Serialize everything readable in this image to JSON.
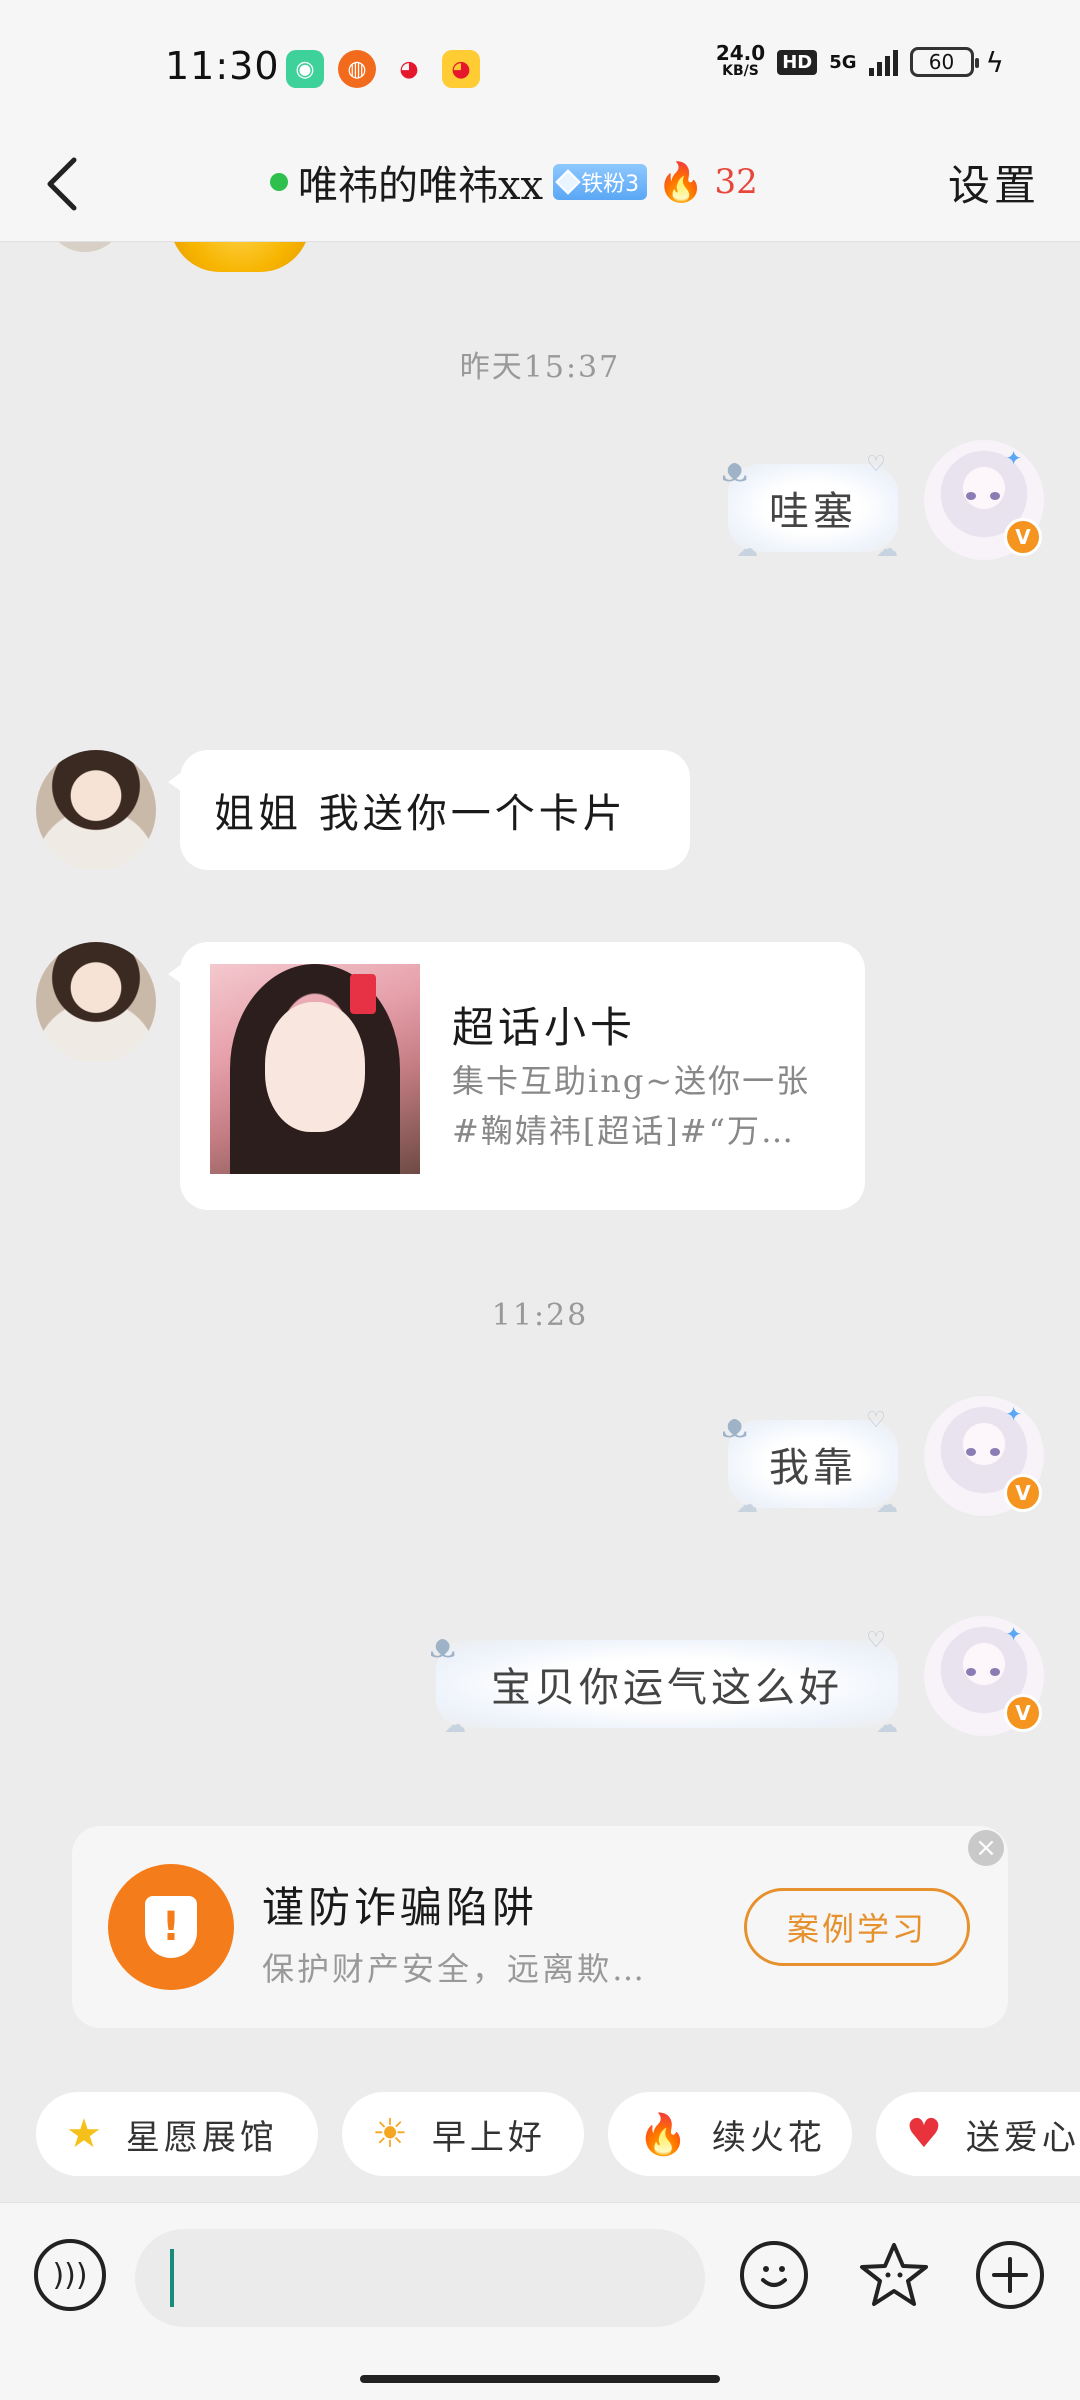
{
  "status_bar": {
    "time": "11:30",
    "net_speed_value": "24.0",
    "net_speed_unit": "KB/S",
    "hd": "HD",
    "network": "5G",
    "battery": "60",
    "apps": [
      "app-icon-green",
      "app-icon-orange",
      "weibo-icon",
      "weibo-icon-yellow"
    ]
  },
  "header": {
    "title": "唯祎的唯祎xx",
    "fan_badge": "铁粉3",
    "fire_count": "32",
    "settings": "设置"
  },
  "messages": [
    {
      "type": "timestamp",
      "text": "昨天15:37"
    },
    {
      "type": "sent",
      "text": "哇塞"
    },
    {
      "type": "received",
      "text": "姐姐 我送你一个卡片"
    },
    {
      "type": "card",
      "title": "超话小卡",
      "desc_line1": "集卡互助ing~送你一张",
      "desc_line2": "#鞠婧祎[超话]#“万…"
    },
    {
      "type": "timestamp",
      "text": "11:28"
    },
    {
      "type": "sent",
      "text": "我靠"
    },
    {
      "type": "sent",
      "text": "宝贝你运气这么好"
    }
  ],
  "fraud_banner": {
    "title": "谨防诈骗陷阱",
    "desc": "保护财产安全，远离欺…",
    "button": "案例学习"
  },
  "quick_chips": [
    {
      "icon": "star-icon",
      "label": "星愿展馆"
    },
    {
      "icon": "sun-icon",
      "label": "早上好"
    },
    {
      "icon": "fire-icon",
      "label": "续火花"
    },
    {
      "icon": "heart-icon",
      "label": "送爱心"
    }
  ],
  "input": {
    "placeholder": ""
  },
  "colors": {
    "accent_orange": "#f57c1a",
    "fire_red": "#e8463a",
    "online_green": "#2ec04c",
    "fan_badge_blue": "#5aa7f5"
  }
}
